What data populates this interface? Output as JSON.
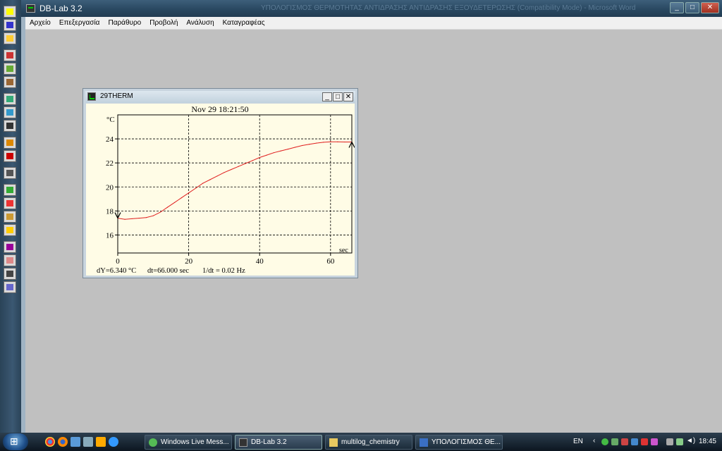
{
  "window": {
    "title": "DB-Lab 3.2",
    "doc_title": "ΥΠΟΛΟΓΙΣΜΟΣ ΘΕΡΜΟΤΗΤΑΣ ΑΝΤΙΔΡΑΣΗΣ ΑΝΤΙΔΡΑΣΗΣ ΕΞΟΥΔΕΤΕΡΩΣΗΣ (Compatibility Mode) - Microsoft Word",
    "minimize": "_",
    "maximize": "□",
    "close": "✕"
  },
  "menu": [
    "Αρχείο",
    "Επεξεργασία",
    "Παράθυρο",
    "Προβολή",
    "Ανάλυση",
    "Καταγραφέας"
  ],
  "toolbar_icons": [
    "new-icon",
    "save-icon",
    "print-icon",
    "cut-icon",
    "copy-icon",
    "paste-icon",
    "zoom-in-icon",
    "zoom-out-icon",
    "zoom-fit-icon",
    "cursor-icon",
    "delete-cursor-icon",
    "calculator-icon",
    "smooth-icon",
    "fruit-icon",
    "hand-icon",
    "stop-icon",
    "color-icon",
    "gauge-icon",
    "table-icon",
    "graph-icon"
  ],
  "graph_window": {
    "title": "29THERM",
    "timestamp": "Nov 29 18:21:50",
    "y_unit": "°C",
    "x_unit": "sec",
    "status": {
      "dy": "dY=6.340 °C",
      "dt": "dt=66.000 sec",
      "freq": "1/dt = 0.02 Hz"
    }
  },
  "chart_data": {
    "type": "line",
    "title": "Nov 29 18:21:50",
    "xlabel": "sec",
    "ylabel": "°C",
    "xlim": [
      0,
      66
    ],
    "ylim": [
      14.5,
      26
    ],
    "xticks": [
      0,
      20,
      40,
      60
    ],
    "yticks": [
      16,
      18,
      20,
      22,
      24
    ],
    "grid": true,
    "series_color": "#e02020",
    "series": [
      {
        "x": [
          0,
          2,
          4,
          6,
          8,
          10,
          12,
          14,
          16,
          18,
          20,
          22,
          24,
          26,
          28,
          30,
          32,
          34,
          36,
          38,
          40,
          42,
          44,
          46,
          48,
          50,
          52,
          54,
          56,
          58,
          60,
          62,
          64,
          66
        ],
        "values": [
          17.4,
          17.3,
          17.35,
          17.4,
          17.45,
          17.6,
          17.9,
          18.3,
          18.7,
          19.1,
          19.5,
          19.9,
          20.3,
          20.6,
          20.9,
          21.2,
          21.45,
          21.7,
          21.95,
          22.2,
          22.45,
          22.65,
          22.85,
          23.0,
          23.15,
          23.3,
          23.45,
          23.55,
          23.65,
          23.72,
          23.75,
          23.75,
          23.74,
          23.74
        ]
      }
    ],
    "cursors": [
      {
        "x": 0,
        "y": 17.4
      },
      {
        "x": 66,
        "y": 23.74
      }
    ]
  },
  "taskbar": {
    "tasks": [
      {
        "label": "Windows Live Mess...",
        "icon": "messenger-icon"
      },
      {
        "label": "DB-Lab 3.2",
        "icon": "dblab-icon",
        "active": true
      },
      {
        "label": "multilog_chemistry",
        "icon": "folder-icon"
      },
      {
        "label": "ΥΠΟΛΟΓΙΣΜΟΣ ΘΕ...",
        "icon": "word-icon"
      }
    ],
    "lang": "EN",
    "clock": "18:45"
  }
}
